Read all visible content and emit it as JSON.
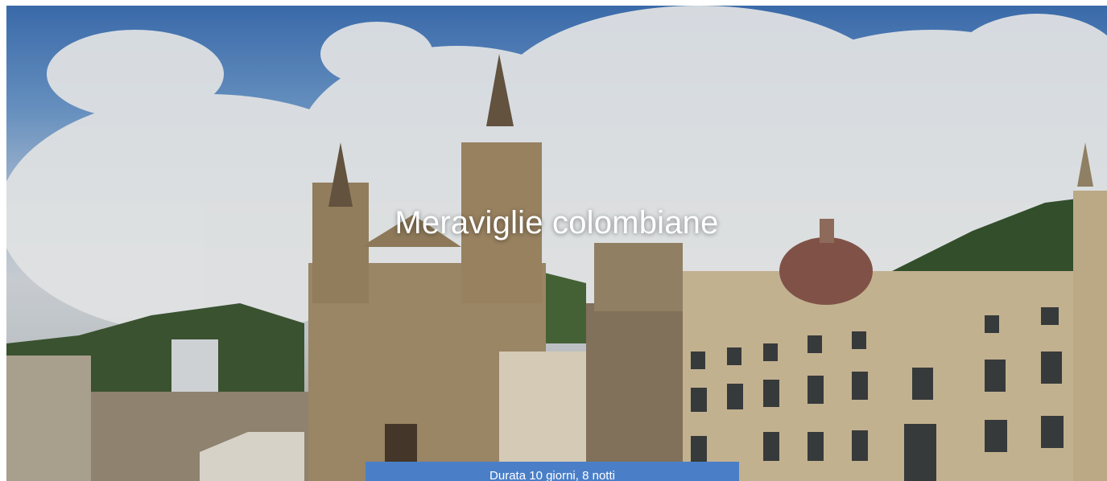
{
  "hero": {
    "title": "Meraviglie colombiane",
    "image_subject": "cathedral-plaza-photo"
  },
  "duration": {
    "text": "Durata 10 giorni, 8 notti"
  },
  "colors": {
    "duration_bar": "#4a7fc8",
    "title_text": "#ffffff"
  }
}
